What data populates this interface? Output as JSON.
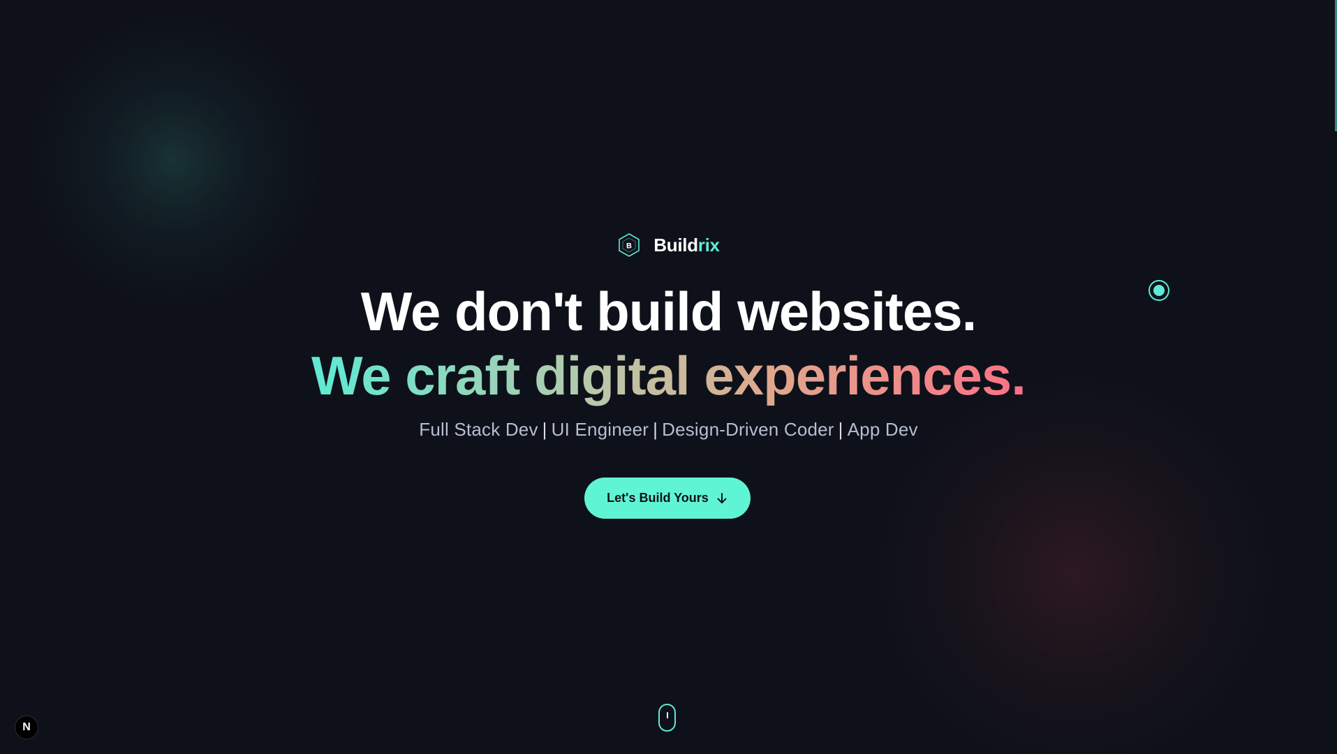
{
  "brand": {
    "name_main": "Build",
    "name_accent": "rix",
    "logo_letter": "B"
  },
  "hero": {
    "headline_1": "We don't build websites.",
    "headline_2": "We craft digital experiences.",
    "roles": [
      "Full Stack Dev",
      "UI Engineer",
      "Design-Driven Coder",
      "App Dev"
    ],
    "role_separator": "|",
    "cta_label": "Let's Build Yours"
  },
  "dev_badge": {
    "letter": "N"
  },
  "colors": {
    "background": "#0e111a",
    "accent": "#5eead4",
    "cta": "#5ff5d4",
    "gradient_end": "#fb7185"
  },
  "icons": [
    "hexagon-logo-icon",
    "arrow-down-icon",
    "radio-dot-icon",
    "scroll-mouse-icon",
    "nextjs-badge-icon"
  ]
}
